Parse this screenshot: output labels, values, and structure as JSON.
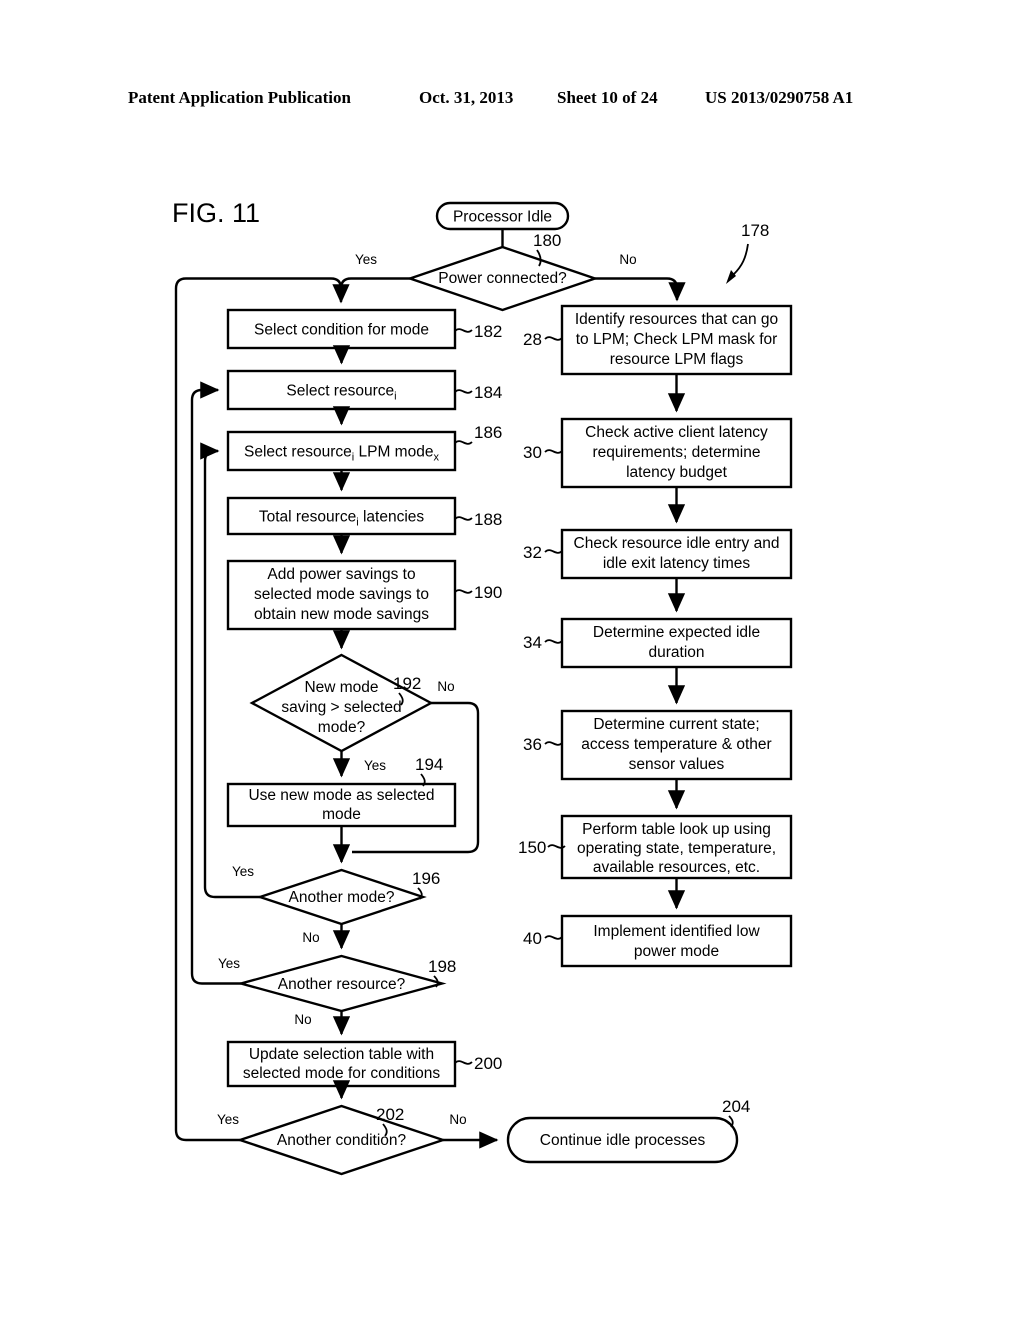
{
  "header": {
    "publication": "Patent Application Publication",
    "date": "Oct. 31, 2013",
    "sheet": "Sheet 10 of 24",
    "number": "US 2013/0290758 A1"
  },
  "figure": {
    "label": "FIG. 11",
    "overall_ref": "178"
  },
  "nodes": {
    "start": {
      "text": "Processor Idle",
      "type": "terminal"
    },
    "power_connected": {
      "text": "Power connected?",
      "ref": "180",
      "type": "decision"
    },
    "select_condition": {
      "text": "Select condition for mode",
      "ref": "182",
      "type": "process"
    },
    "select_resource": {
      "text_a": "Select resource",
      "sub_a": "i",
      "ref": "184",
      "type": "process"
    },
    "select_lpm_mode": {
      "text_a": "Select resource",
      "sub_a": "i",
      "text_b": " LPM mode",
      "sub_b": "x",
      "ref": "186",
      "type": "process"
    },
    "total_latencies": {
      "text_a": "Total resource",
      "sub_a": "i",
      "text_b": " latencies",
      "ref": "188",
      "type": "process"
    },
    "add_power_savings": {
      "lines": [
        "Add power savings to",
        "selected mode savings to",
        "obtain new mode savings"
      ],
      "ref": "190",
      "type": "process"
    },
    "new_mode_saving": {
      "lines": [
        "New mode",
        "saving > selected",
        "mode?"
      ],
      "ref": "192",
      "type": "decision"
    },
    "use_new_mode": {
      "lines": [
        "Use new mode as selected",
        "mode"
      ],
      "ref": "194",
      "type": "process"
    },
    "another_mode": {
      "text": "Another mode?",
      "ref": "196",
      "type": "decision"
    },
    "another_resource": {
      "text": "Another resource?",
      "ref": "198",
      "type": "decision"
    },
    "update_selection_table": {
      "lines": [
        "Update selection table with",
        "selected mode for conditions"
      ],
      "ref": "200",
      "type": "process"
    },
    "another_condition": {
      "text": "Another condition?",
      "ref": "202",
      "type": "decision"
    },
    "continue_idle": {
      "text": "Continue idle processes",
      "ref": "204",
      "type": "terminal"
    },
    "identify_resources": {
      "lines": [
        "Identify resources that can go",
        "to LPM; Check LPM mask for",
        "resource LPM flags"
      ],
      "ref": "28",
      "type": "process"
    },
    "check_latency": {
      "lines": [
        "Check active client latency",
        "requirements; determine",
        "latency budget"
      ],
      "ref": "30",
      "type": "process"
    },
    "check_idle_entry": {
      "lines": [
        "Check resource idle entry and",
        "idle exit latency times"
      ],
      "ref": "32",
      "type": "process"
    },
    "expected_idle_duration": {
      "lines": [
        "Determine expected idle",
        "duration"
      ],
      "ref": "34",
      "type": "process"
    },
    "determine_current_state": {
      "lines": [
        "Determine current state;",
        "access temperature & other",
        "sensor values"
      ],
      "ref": "36",
      "type": "process"
    },
    "table_lookup": {
      "lines": [
        "Perform table look up using",
        "operating state, temperature,",
        "available resources, etc."
      ],
      "ref": "150",
      "type": "process"
    },
    "implement_lpm": {
      "lines": [
        "Implement identified low",
        "power mode"
      ],
      "ref": "40",
      "type": "process"
    }
  },
  "edge_labels": {
    "yes": "Yes",
    "no": "No"
  },
  "colors": {
    "ink": "#000000",
    "paper": "#ffffff"
  }
}
